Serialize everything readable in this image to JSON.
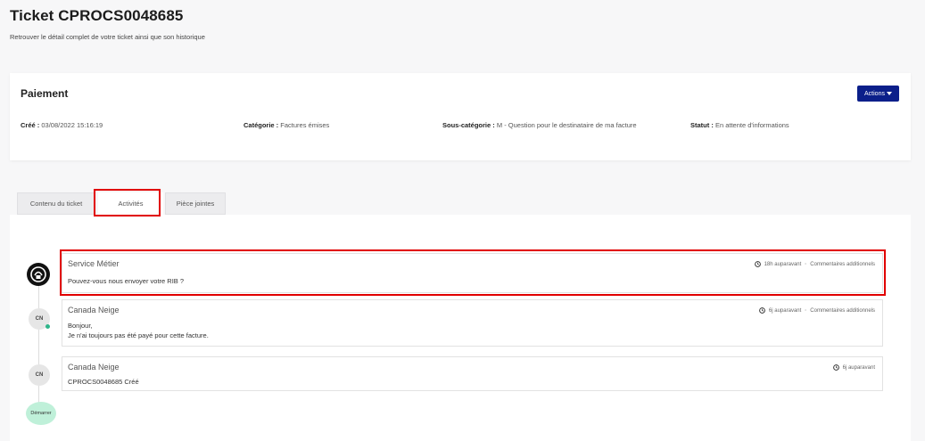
{
  "header": {
    "title": "Ticket CPROCS0048685",
    "subtitle": "Retrouver le détail complet de votre ticket ainsi que son historique"
  },
  "ticket": {
    "name": "Paiement",
    "actions_label": "Actions",
    "created_label": "Créé :",
    "created_value": "03/08/2022 15:16:19",
    "category_label": "Catégorie :",
    "category_value": "Factures émises",
    "subcategory_label": "Sous-catégorie :",
    "subcategory_value": "M - Question pour le destinataire de ma facture",
    "status_label": "Statut :",
    "status_value": "En attente d'informations"
  },
  "tabs": [
    {
      "label": "Contenu du ticket"
    },
    {
      "label": "Activités",
      "active": true
    },
    {
      "label": "Pièce jointes"
    }
  ],
  "activities": [
    {
      "author": "Service Métier",
      "time": "18h auparavant",
      "tag": "Commentaires additionnels",
      "body_lines": [
        "Pouvez-vous nous envoyer votre RIB ?"
      ],
      "avatar": "service-icon"
    },
    {
      "author": "Canada Neige",
      "time": "6j auparavant",
      "tag": "Commentaires additionnels",
      "body_lines": [
        "Bonjour,",
        "Je n'ai toujours pas été payé pour cette facture."
      ],
      "avatar": "CN"
    },
    {
      "author": "Canada Neige",
      "time": "6j auparavant",
      "tag": "",
      "body_lines": [
        "CPROCS0048685 Créé"
      ],
      "avatar": "CN"
    }
  ],
  "timeline_start": "Démarrer",
  "colors": {
    "accent": "#0b1f8a",
    "highlight": "#e10000",
    "online": "#2fb58a",
    "start_bubble": "#bff0d9"
  }
}
